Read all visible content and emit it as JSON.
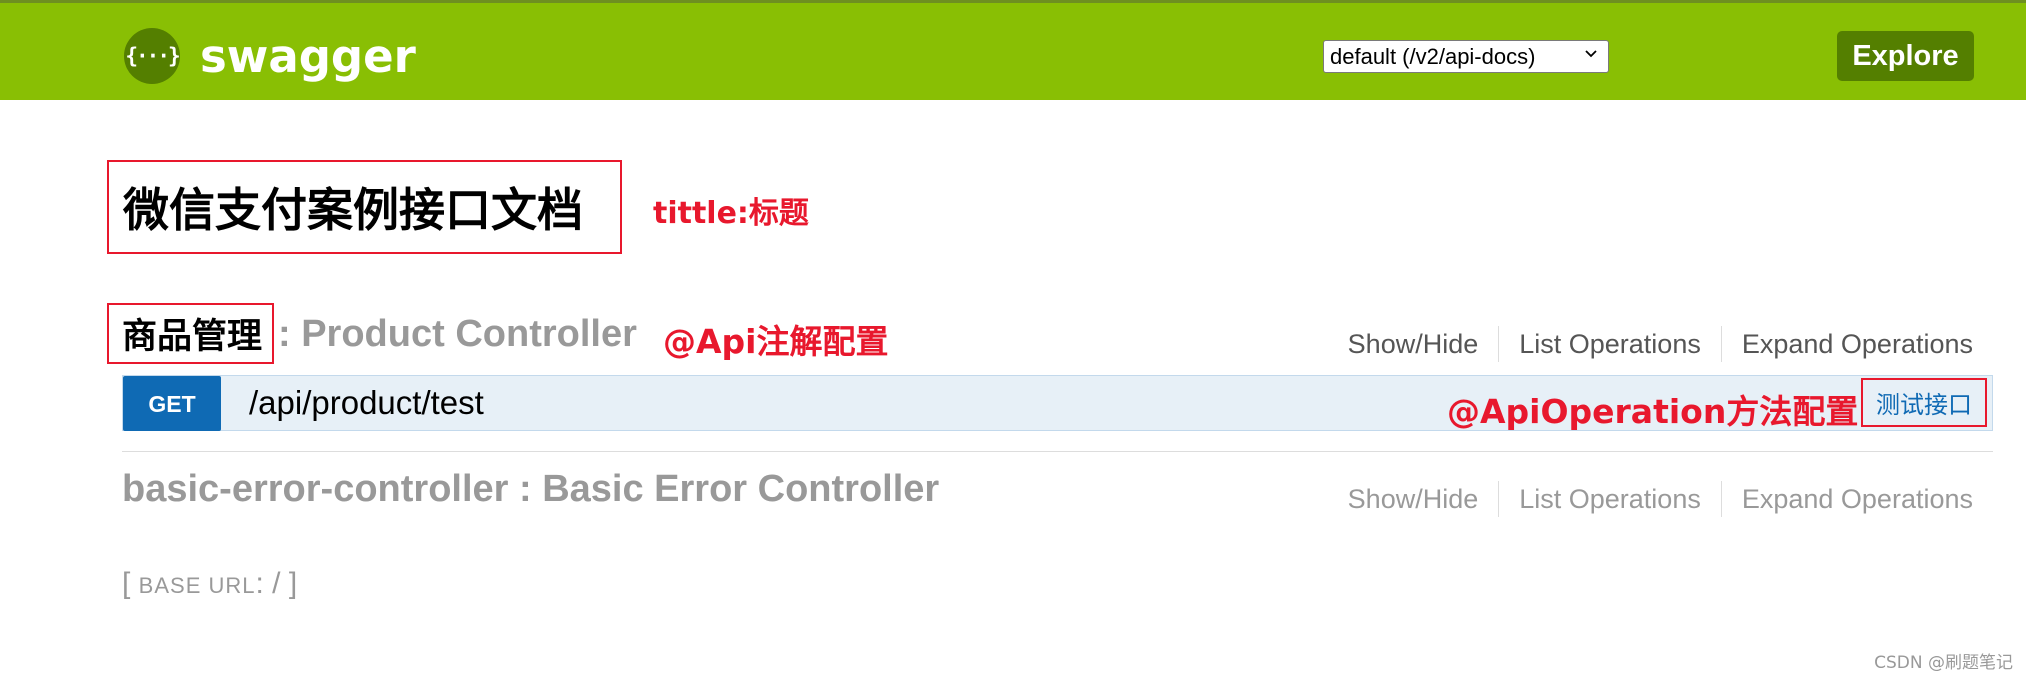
{
  "header": {
    "logo_glyph": "{···}",
    "logo_text": "swagger",
    "spec_select_value": "default (/v2/api-docs)",
    "explore_label": "Explore",
    "bg_color": "#89bf04",
    "button_color": "#547f00"
  },
  "api_info": {
    "title": "微信支付案例接口文档"
  },
  "annotations": {
    "title_note": "tittle:标题",
    "api_note": "@Api注解配置",
    "operation_note": "@ApiOperation方法配置",
    "color": "#e8182d"
  },
  "resources": [
    {
      "name": "商品管理",
      "description": ": Product Controller",
      "actions": [
        "Show/Hide",
        "List Operations",
        "Expand Operations"
      ],
      "operations": [
        {
          "method": "GET",
          "path": "/api/product/test",
          "summary": "测试接口",
          "method_color": "#0f6ab4"
        }
      ]
    },
    {
      "name": "basic-error-controller : Basic Error Controller",
      "actions": [
        "Show/Hide",
        "List Operations",
        "Expand Operations"
      ]
    }
  ],
  "footer": {
    "base_url_open": "[ ",
    "base_url_label": "BASE URL",
    "base_url_value": ": / ]",
    "watermark": "CSDN @刷题笔记"
  }
}
